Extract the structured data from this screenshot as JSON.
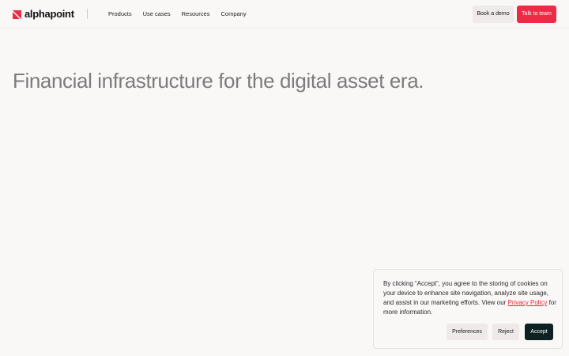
{
  "header": {
    "logo_text": "alphapoint",
    "brand_color": "#ee2b47",
    "nav": [
      "Products",
      "Use cases",
      "Resources",
      "Company"
    ],
    "book_demo_label": "Book a demo",
    "talk_label": "Talk to team"
  },
  "hero": {
    "headline": "Financial infrastructure for the digital asset era."
  },
  "cookie_banner": {
    "text_before_link": "By clicking “Accept”, you agree to the storing of cookies on your device to enhance site navigation, analyze site usage, and assist in our marketing efforts. View our ",
    "link_text": "Privacy Policy",
    "text_after_link": " for more information.",
    "preferences_label": "Preferences",
    "reject_label": "Reject",
    "accept_label": "Accept"
  }
}
